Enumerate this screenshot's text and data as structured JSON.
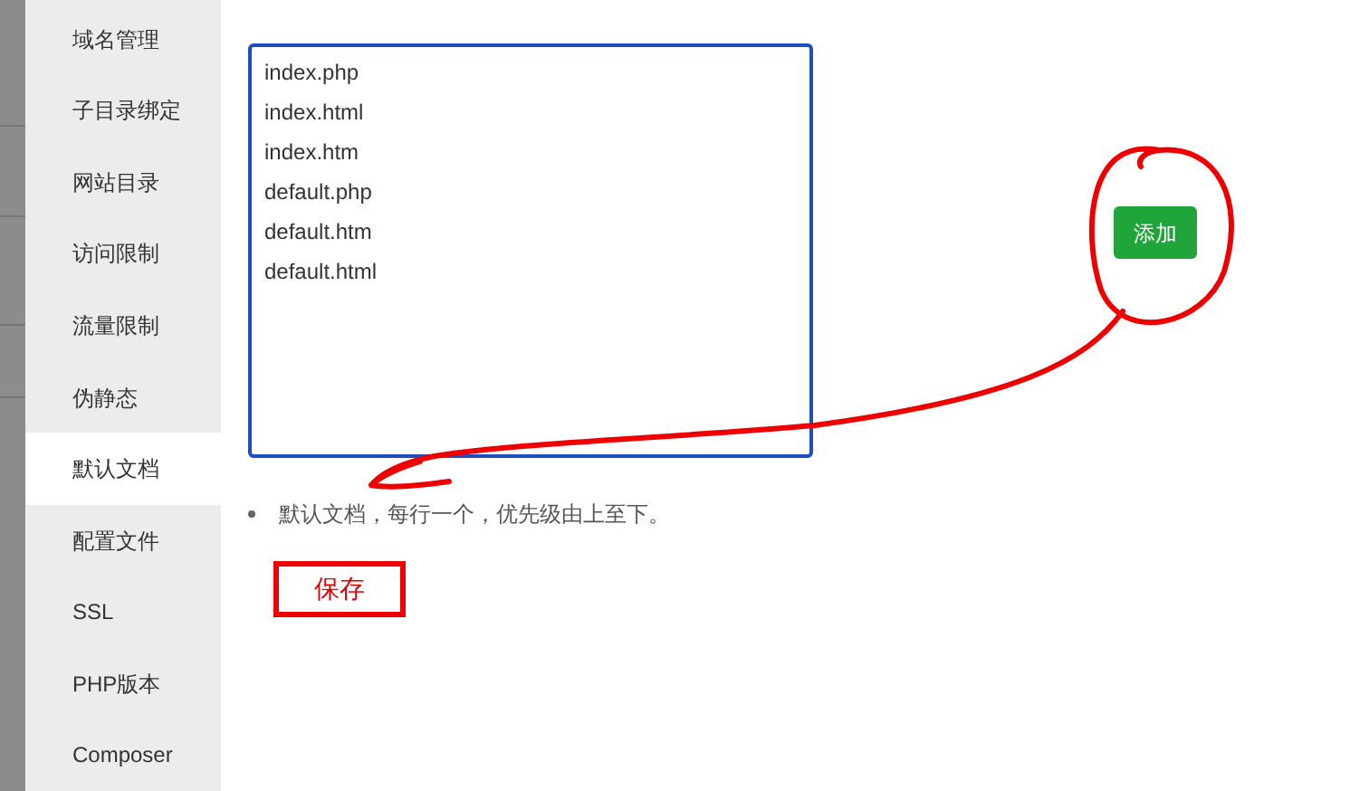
{
  "sidebar": {
    "items": [
      {
        "label": "域名管理",
        "selected": false
      },
      {
        "label": "子目录绑定",
        "selected": false
      },
      {
        "label": "网站目录",
        "selected": false
      },
      {
        "label": "访问限制",
        "selected": false
      },
      {
        "label": "流量限制",
        "selected": false
      },
      {
        "label": "伪静态",
        "selected": false
      },
      {
        "label": "默认文档",
        "selected": true
      },
      {
        "label": "配置文件",
        "selected": false
      },
      {
        "label": "SSL",
        "selected": false
      },
      {
        "label": "PHP版本",
        "selected": false
      },
      {
        "label": "Composer",
        "selected": false
      }
    ]
  },
  "default_documents": {
    "lines": [
      "index.php",
      "index.html",
      "index.htm",
      "default.php",
      "default.htm",
      "default.html"
    ]
  },
  "add_button": "添加",
  "hint": "默认文档，每行一个，优先级由上至下。",
  "save_button": "保存"
}
